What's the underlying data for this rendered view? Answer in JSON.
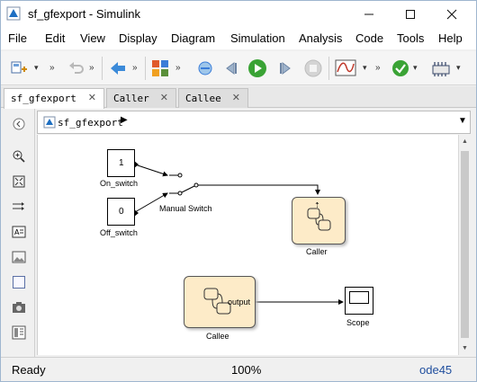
{
  "window": {
    "title": "sf_gfexport - Simulink"
  },
  "menu": [
    "File",
    "Edit",
    "View",
    "Display",
    "Diagram",
    "Simulation",
    "Analysis",
    "Code",
    "Tools",
    "Help"
  ],
  "tabs": [
    {
      "label": "sf_gfexport",
      "close": "✕"
    },
    {
      "label": "Caller",
      "close": "✕"
    },
    {
      "label": "Callee",
      "close": "✕"
    }
  ],
  "address": {
    "path": "sf_gfexport"
  },
  "diagram": {
    "const_on_value": "1",
    "const_on_name": "On_switch",
    "const_off_value": "0",
    "const_off_name": "Off_switch",
    "switch_name": "Manual Switch",
    "caller_name": "Caller",
    "callee_name": "Callee",
    "callee_port": "output",
    "scope_name": "Scope"
  },
  "status": {
    "state": "Ready",
    "zoom": "100%",
    "solver": "ode45"
  },
  "colors": {
    "chart_fill": "#fdebc8",
    "chart_border": "#555555",
    "accent_link": "#1f4e9e"
  }
}
